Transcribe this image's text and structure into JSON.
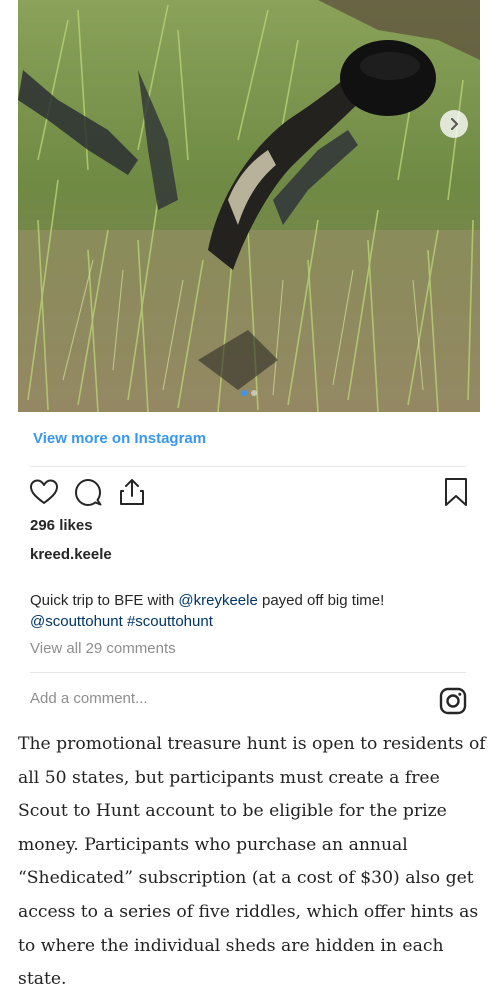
{
  "post": {
    "view_more_label": "View more on Instagram",
    "likes": "296 likes",
    "username": "kreed.keele",
    "caption": {
      "part1": "Quick trip to BFE with ",
      "mention1": "@kreykeele",
      "part2": " payed off big time!",
      "mention2": "@scouttohunt",
      "hashtag": "#scouttohunt"
    },
    "view_comments": "View all 29 comments",
    "add_comment_placeholder": "Add a comment..."
  },
  "icons": {
    "like": "heart-icon",
    "comment": "comment-icon",
    "share": "share-icon",
    "save": "bookmark-icon",
    "next": "chevron-right-icon",
    "logo": "instagram-icon"
  },
  "article": {
    "paragraph": "The promotional treasure hunt is open to residents of all 50 states, but participants must create a free Scout to Hunt account to be eligible for the prize money. Participants who purchase an annual “Shedicated” subscription (at a cost of $30) also get access to a series of five riddles, which offer hints as to where the individual sheds are hidden in each state."
  },
  "colors": {
    "link_blue": "#3897f0",
    "mention_blue": "#003569",
    "muted_gray": "#8e8e8e",
    "text_dark": "#262626"
  }
}
